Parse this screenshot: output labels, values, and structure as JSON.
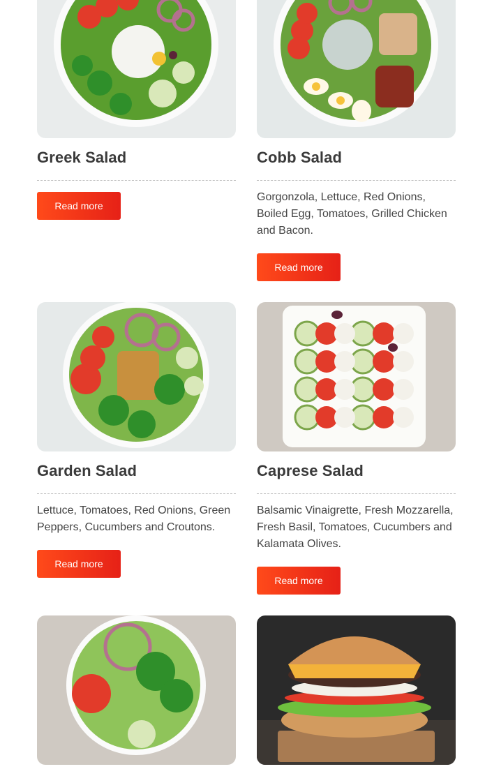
{
  "cards": [
    {
      "title": "Greek Salad",
      "description": "",
      "button": "Read more",
      "image": "greek-salad"
    },
    {
      "title": "Cobb Salad",
      "description": "Gorgonzola, Lettuce, Red Onions, Boiled Egg, Tomatoes, Grilled Chicken and Bacon.",
      "button": "Read more",
      "image": "cobb-salad"
    },
    {
      "title": "Garden Salad",
      "description": "Lettuce, Tomatoes, Red Onions, Green Peppers, Cucumbers and Croutons.",
      "button": "Read more",
      "image": "garden-salad"
    },
    {
      "title": "Caprese Salad",
      "description": "Balsamic Vinaigrette, Fresh Mozzarella, Fresh Basil, Tomatoes, Cucumbers and Kalamata Olives.",
      "button": "Read more",
      "image": "caprese-salad"
    },
    {
      "title": "",
      "description": "",
      "button": "",
      "image": "side-salad"
    },
    {
      "title": "",
      "description": "",
      "button": "",
      "image": "cheeseburger"
    }
  ],
  "colors": {
    "accent_start": "#ff4a1a",
    "accent_end": "#e62117",
    "title": "#3a3a3a"
  }
}
